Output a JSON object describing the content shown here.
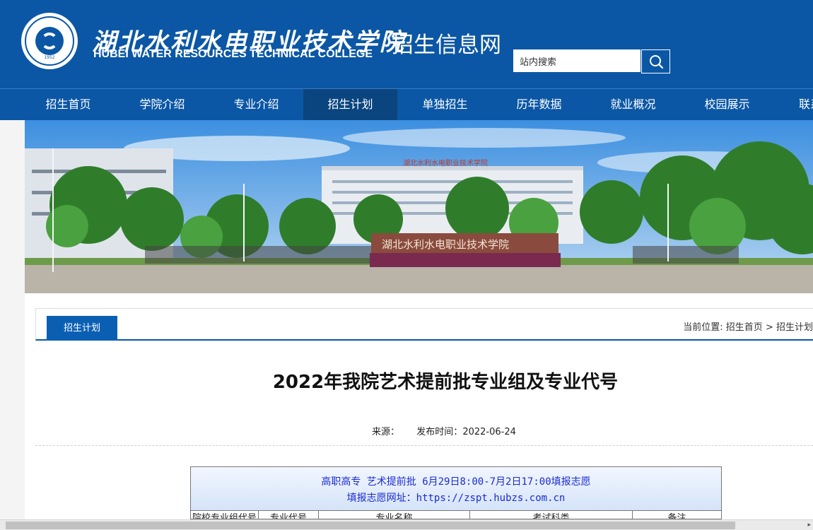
{
  "header": {
    "college_name_cn": "湖北水利水电职业技术学院",
    "college_name_en": "HUBEI WATER RESOURCES TECHNICAL COLLEGE",
    "site_title": "招生信息网",
    "logo_year": "1952",
    "search": {
      "value": "站内搜索",
      "button_icon": "search-icon"
    }
  },
  "nav": {
    "items": [
      {
        "label": "招生首页"
      },
      {
        "label": "学院介绍"
      },
      {
        "label": "专业介绍"
      },
      {
        "label": "招生计划"
      },
      {
        "label": "单独招生"
      },
      {
        "label": "历年数据"
      },
      {
        "label": "就业概况"
      },
      {
        "label": "校园展示"
      },
      {
        "label": "联系"
      }
    ],
    "active": "招生计划"
  },
  "banner": {
    "building_sign": "湖北水利水电职业技术学院",
    "gate_sign": "湖北水利水电职业技术学院"
  },
  "panel": {
    "tab_label": "招生计划",
    "breadcrumb_prefix": "当前位置:",
    "breadcrumb_home": "招生首页",
    "breadcrumb_sep": ">",
    "breadcrumb_current": "招生计划"
  },
  "article": {
    "title": "2022年我院艺术提前批专业组及专业代号",
    "source_label": "来源：",
    "publish_label": "发布时间：",
    "publish_date": "2022-06-24"
  },
  "table": {
    "caption_line1": "高职高专 艺术提前批 6月29日8:00-7月2日17:00填报志愿",
    "caption_line2": "填报志愿网址：https://zspt.hubzs.com.cn",
    "headers": [
      "院校专业组代号",
      "专业代号",
      "专业名称",
      "考试科类",
      "备注"
    ]
  },
  "colors": {
    "brand_blue": "#0b57a5",
    "nav_active": "#0a457f",
    "tab_blue": "#0b5fb3",
    "table_text_blue": "#1b2bd0"
  }
}
